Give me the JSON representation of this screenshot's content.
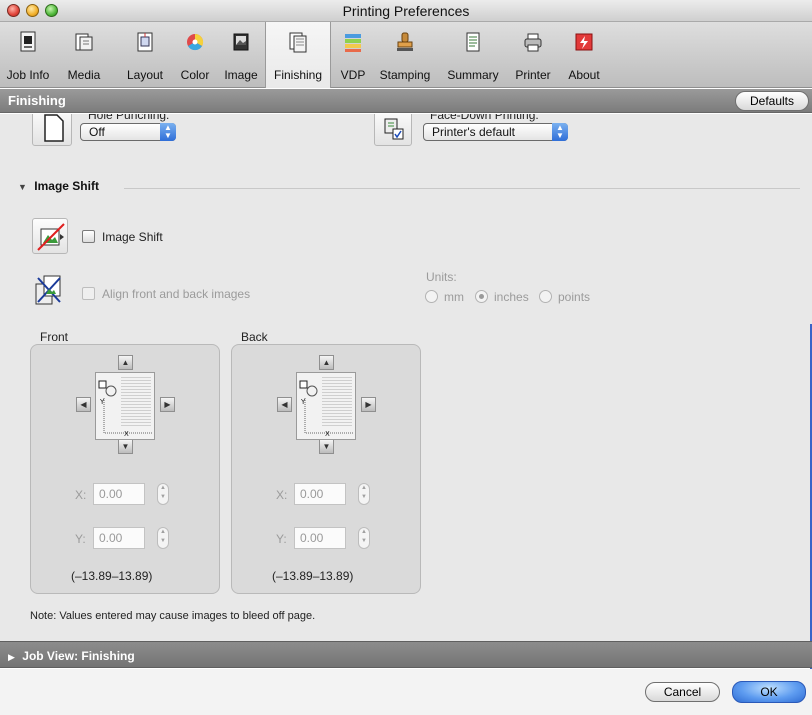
{
  "window": {
    "title": "Printing Preferences"
  },
  "toolbar": {
    "items": [
      {
        "label": "Job Info",
        "icon": "job-info-icon"
      },
      {
        "label": "Media",
        "icon": "media-icon"
      },
      {
        "label": "Layout",
        "icon": "layout-icon"
      },
      {
        "label": "Color",
        "icon": "color-icon"
      },
      {
        "label": "Image",
        "icon": "image-icon"
      },
      {
        "label": "Finishing",
        "icon": "finishing-icon",
        "selected": true
      },
      {
        "label": "VDP",
        "icon": "vdp-icon"
      },
      {
        "label": "Stamping",
        "icon": "stamping-icon"
      },
      {
        "label": "Summary",
        "icon": "summary-icon"
      },
      {
        "label": "Printer",
        "icon": "printer-icon"
      },
      {
        "label": "About",
        "icon": "about-icon"
      }
    ]
  },
  "section": {
    "title": "Finishing",
    "defaults_label": "Defaults"
  },
  "hole_punching": {
    "label": "Hole Punching:",
    "value": "Off"
  },
  "face_down": {
    "label": "Face-Down Printing:",
    "value": "Printer's default"
  },
  "image_shift": {
    "title": "Image Shift",
    "checkbox_label": "Image Shift",
    "checked": false,
    "align_label": "Align front and back images",
    "align_enabled": false,
    "units_label": "Units:",
    "units": [
      "mm",
      "inches",
      "points"
    ],
    "selected_unit": "inches",
    "front": {
      "title": "Front",
      "x_label": "X:",
      "x_value": "0.00",
      "y_label": "Y:",
      "y_value": "0.00",
      "range": "(–13.89–13.89)"
    },
    "back": {
      "title": "Back",
      "x_label": "X:",
      "x_value": "0.00",
      "y_label": "Y:",
      "y_value": "0.00",
      "range": "(–13.89–13.89)"
    },
    "note": "Note: Values entered may cause images to bleed off page."
  },
  "job_view": {
    "title": "Job View: Finishing"
  },
  "buttons": {
    "cancel": "Cancel",
    "ok": "OK"
  },
  "colors": {
    "section_bar": "#8a8a8a",
    "accent_blue": "#3a73d9",
    "content_bg": "#e8e8e8"
  }
}
